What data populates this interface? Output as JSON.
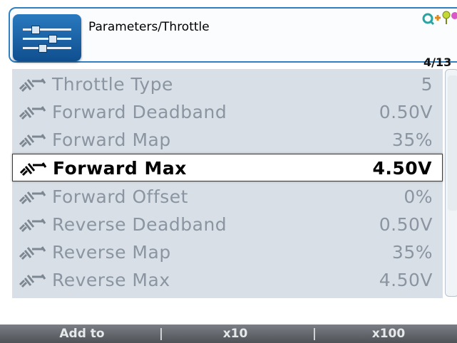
{
  "header": {
    "breadcrumb": "Parameters/Throttle",
    "page_counter": "4/13"
  },
  "params": [
    {
      "name": "Throttle Type",
      "value": "5",
      "selected": false
    },
    {
      "name": "Forward Deadband",
      "value": "0.50V",
      "selected": false
    },
    {
      "name": "Forward Map",
      "value": "35%",
      "selected": false
    },
    {
      "name": "Forward Max",
      "value": "4.50V",
      "selected": true
    },
    {
      "name": "Forward Offset",
      "value": "0%",
      "selected": false
    },
    {
      "name": "Reverse Deadband",
      "value": "0.50V",
      "selected": false
    },
    {
      "name": "Reverse Map",
      "value": "35%",
      "selected": false
    },
    {
      "name": "Reverse Max",
      "value": "4.50V",
      "selected": false
    }
  ],
  "softkeys": {
    "left": "Add to",
    "middle": "x10",
    "right": "x100"
  },
  "icons": {
    "app": "parameters-sliders-icon",
    "row": "wrench-icon",
    "status": "network-status-icon"
  },
  "colors": {
    "accent": "#2f7fc1",
    "list_bg": "#d9dfe6",
    "dim_text": "#8a95a1",
    "selected_text": "#000000"
  }
}
